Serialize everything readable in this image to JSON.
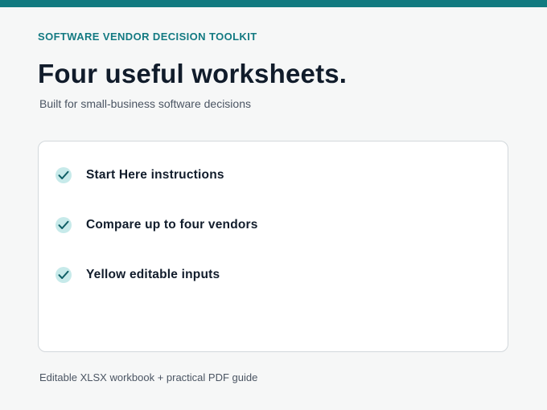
{
  "header": {
    "eyebrow": "SOFTWARE VENDOR DECISION TOOLKIT",
    "title": "Four useful worksheets.",
    "subtitle": "Built for small-business software decisions"
  },
  "features": [
    {
      "label": "Start Here instructions",
      "icon": "check-icon"
    },
    {
      "label": "Compare up to four vendors",
      "icon": "check-icon"
    },
    {
      "label": "Yellow editable inputs",
      "icon": "check-icon"
    }
  ],
  "footer": {
    "note": "Editable XLSX workbook + practical PDF guide"
  },
  "colors": {
    "accent": "#127a80",
    "check_bg": "#c7eaea",
    "check_mark": "#0f5f66",
    "text_dark": "#111c2b",
    "text_muted": "#4b5563"
  }
}
